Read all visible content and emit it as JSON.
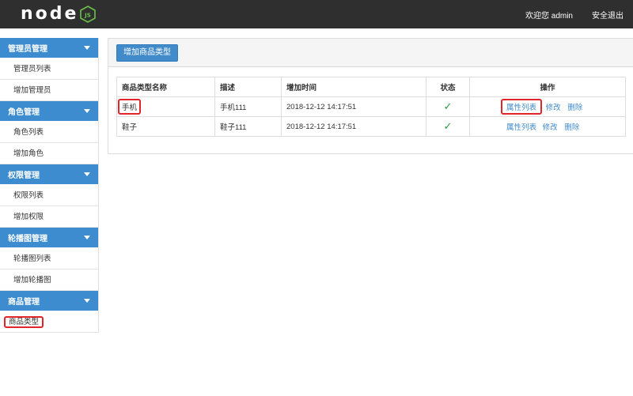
{
  "header": {
    "logo_text": "node",
    "logo_badge": "JS",
    "welcome": "欢迎您 admin",
    "logout": "安全退出"
  },
  "sidebar": {
    "groups": [
      {
        "title": "管理员管理",
        "items": [
          "管理员列表",
          "增加管理员"
        ]
      },
      {
        "title": "角色管理",
        "items": [
          "角色列表",
          "增加角色"
        ]
      },
      {
        "title": "权限管理",
        "items": [
          "权限列表",
          "增加权限"
        ]
      },
      {
        "title": "轮播图管理",
        "items": [
          "轮播图列表",
          "增加轮播图"
        ]
      },
      {
        "title": "商品管理",
        "items": [
          "商品类型"
        ]
      }
    ]
  },
  "main": {
    "add_button": "增加商品类型",
    "table": {
      "headers": [
        "商品类型名称",
        "描述",
        "增加时间",
        "状态",
        "操作"
      ],
      "rows": [
        {
          "name": "手机",
          "desc": "手机111",
          "time": "2018-12-12 14:17:51",
          "status": "✓",
          "ops": [
            "属性列表",
            "修改",
            "删除"
          ]
        },
        {
          "name": "鞋子",
          "desc": "鞋子111",
          "time": "2018-12-12 14:17:51",
          "status": "✓",
          "ops": [
            "属性列表",
            "修改",
            "删除"
          ]
        }
      ]
    }
  },
  "colors": {
    "accent": "#3d8cd0",
    "topbar": "#2f2f2f",
    "highlight": "#e0262a",
    "check": "#2a9a3a"
  }
}
